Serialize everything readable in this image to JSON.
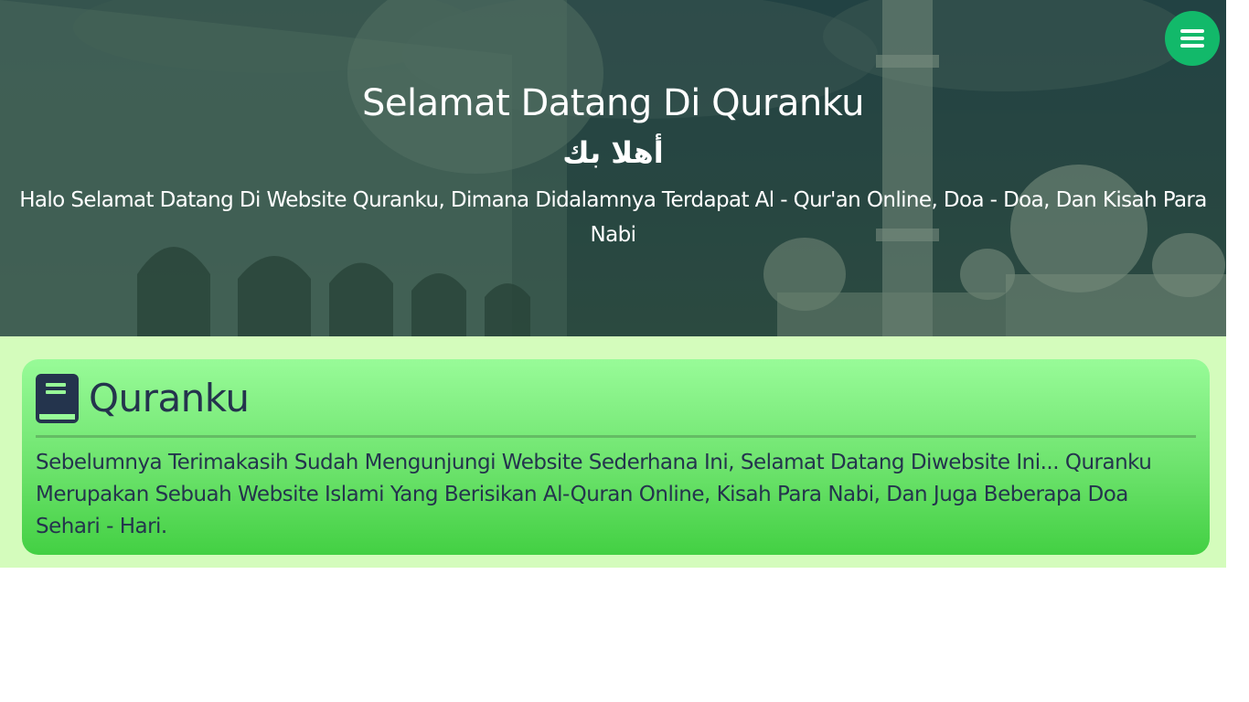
{
  "hero": {
    "title": "Selamat Datang Di Quranku",
    "arabic": "أهلا بك",
    "description": "Halo Selamat Datang Di Website Quranku, Dimana Didalamnya Terdapat Al - Qur'an Online, Doa - Doa, Dan Kisah Para Nabi"
  },
  "nav": {
    "menu_icon": "hamburger-menu-icon",
    "menu_color": "#12b96a"
  },
  "about": {
    "icon": "book-icon",
    "title": "Quranku",
    "text": "Sebelumnya Terimakasih Sudah Mengunjungi Website Sederhana Ini, Selamat Datang Diwebsite Ini... Quranku Merupakan Sebuah Website Islami Yang Berisikan Al-Quran Online, Kisah Para Nabi, Dan Juga Beberapa Doa Sehari - Hari."
  },
  "colors": {
    "section_bg": "#d4fcbc",
    "card_gradient_top": "#98fb98",
    "card_gradient_bottom": "#43d043",
    "card_text": "#24344d"
  }
}
